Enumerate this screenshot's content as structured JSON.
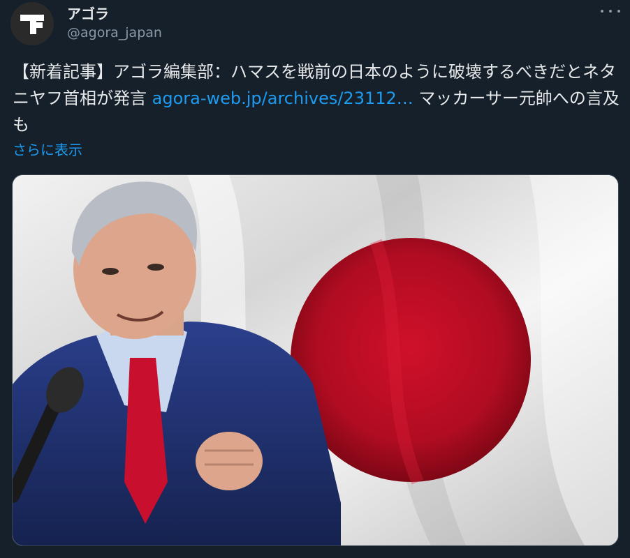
{
  "account": {
    "display_name": "アゴラ",
    "handle": "@agora_japan",
    "avatar_icon": "agora-logo-icon"
  },
  "tweet": {
    "text_before_link": "【新着記事】アゴラ編集部：ハマスを戦前の日本のように破壊するべきだとネタニヤフ首相が発言 ",
    "link_text": "agora-web.jp/archives/23112…",
    "text_after_link": " マッカーサー元帥への言及も",
    "show_more": "さらに表示"
  },
  "menu": {
    "more_icon": "more-horizontal-icon"
  },
  "colors": {
    "background": "#15202b",
    "link": "#1d9bf0",
    "secondary_text": "#8b98a5",
    "primary_text": "#e7e9ea",
    "flag_red": "#c8102e"
  }
}
